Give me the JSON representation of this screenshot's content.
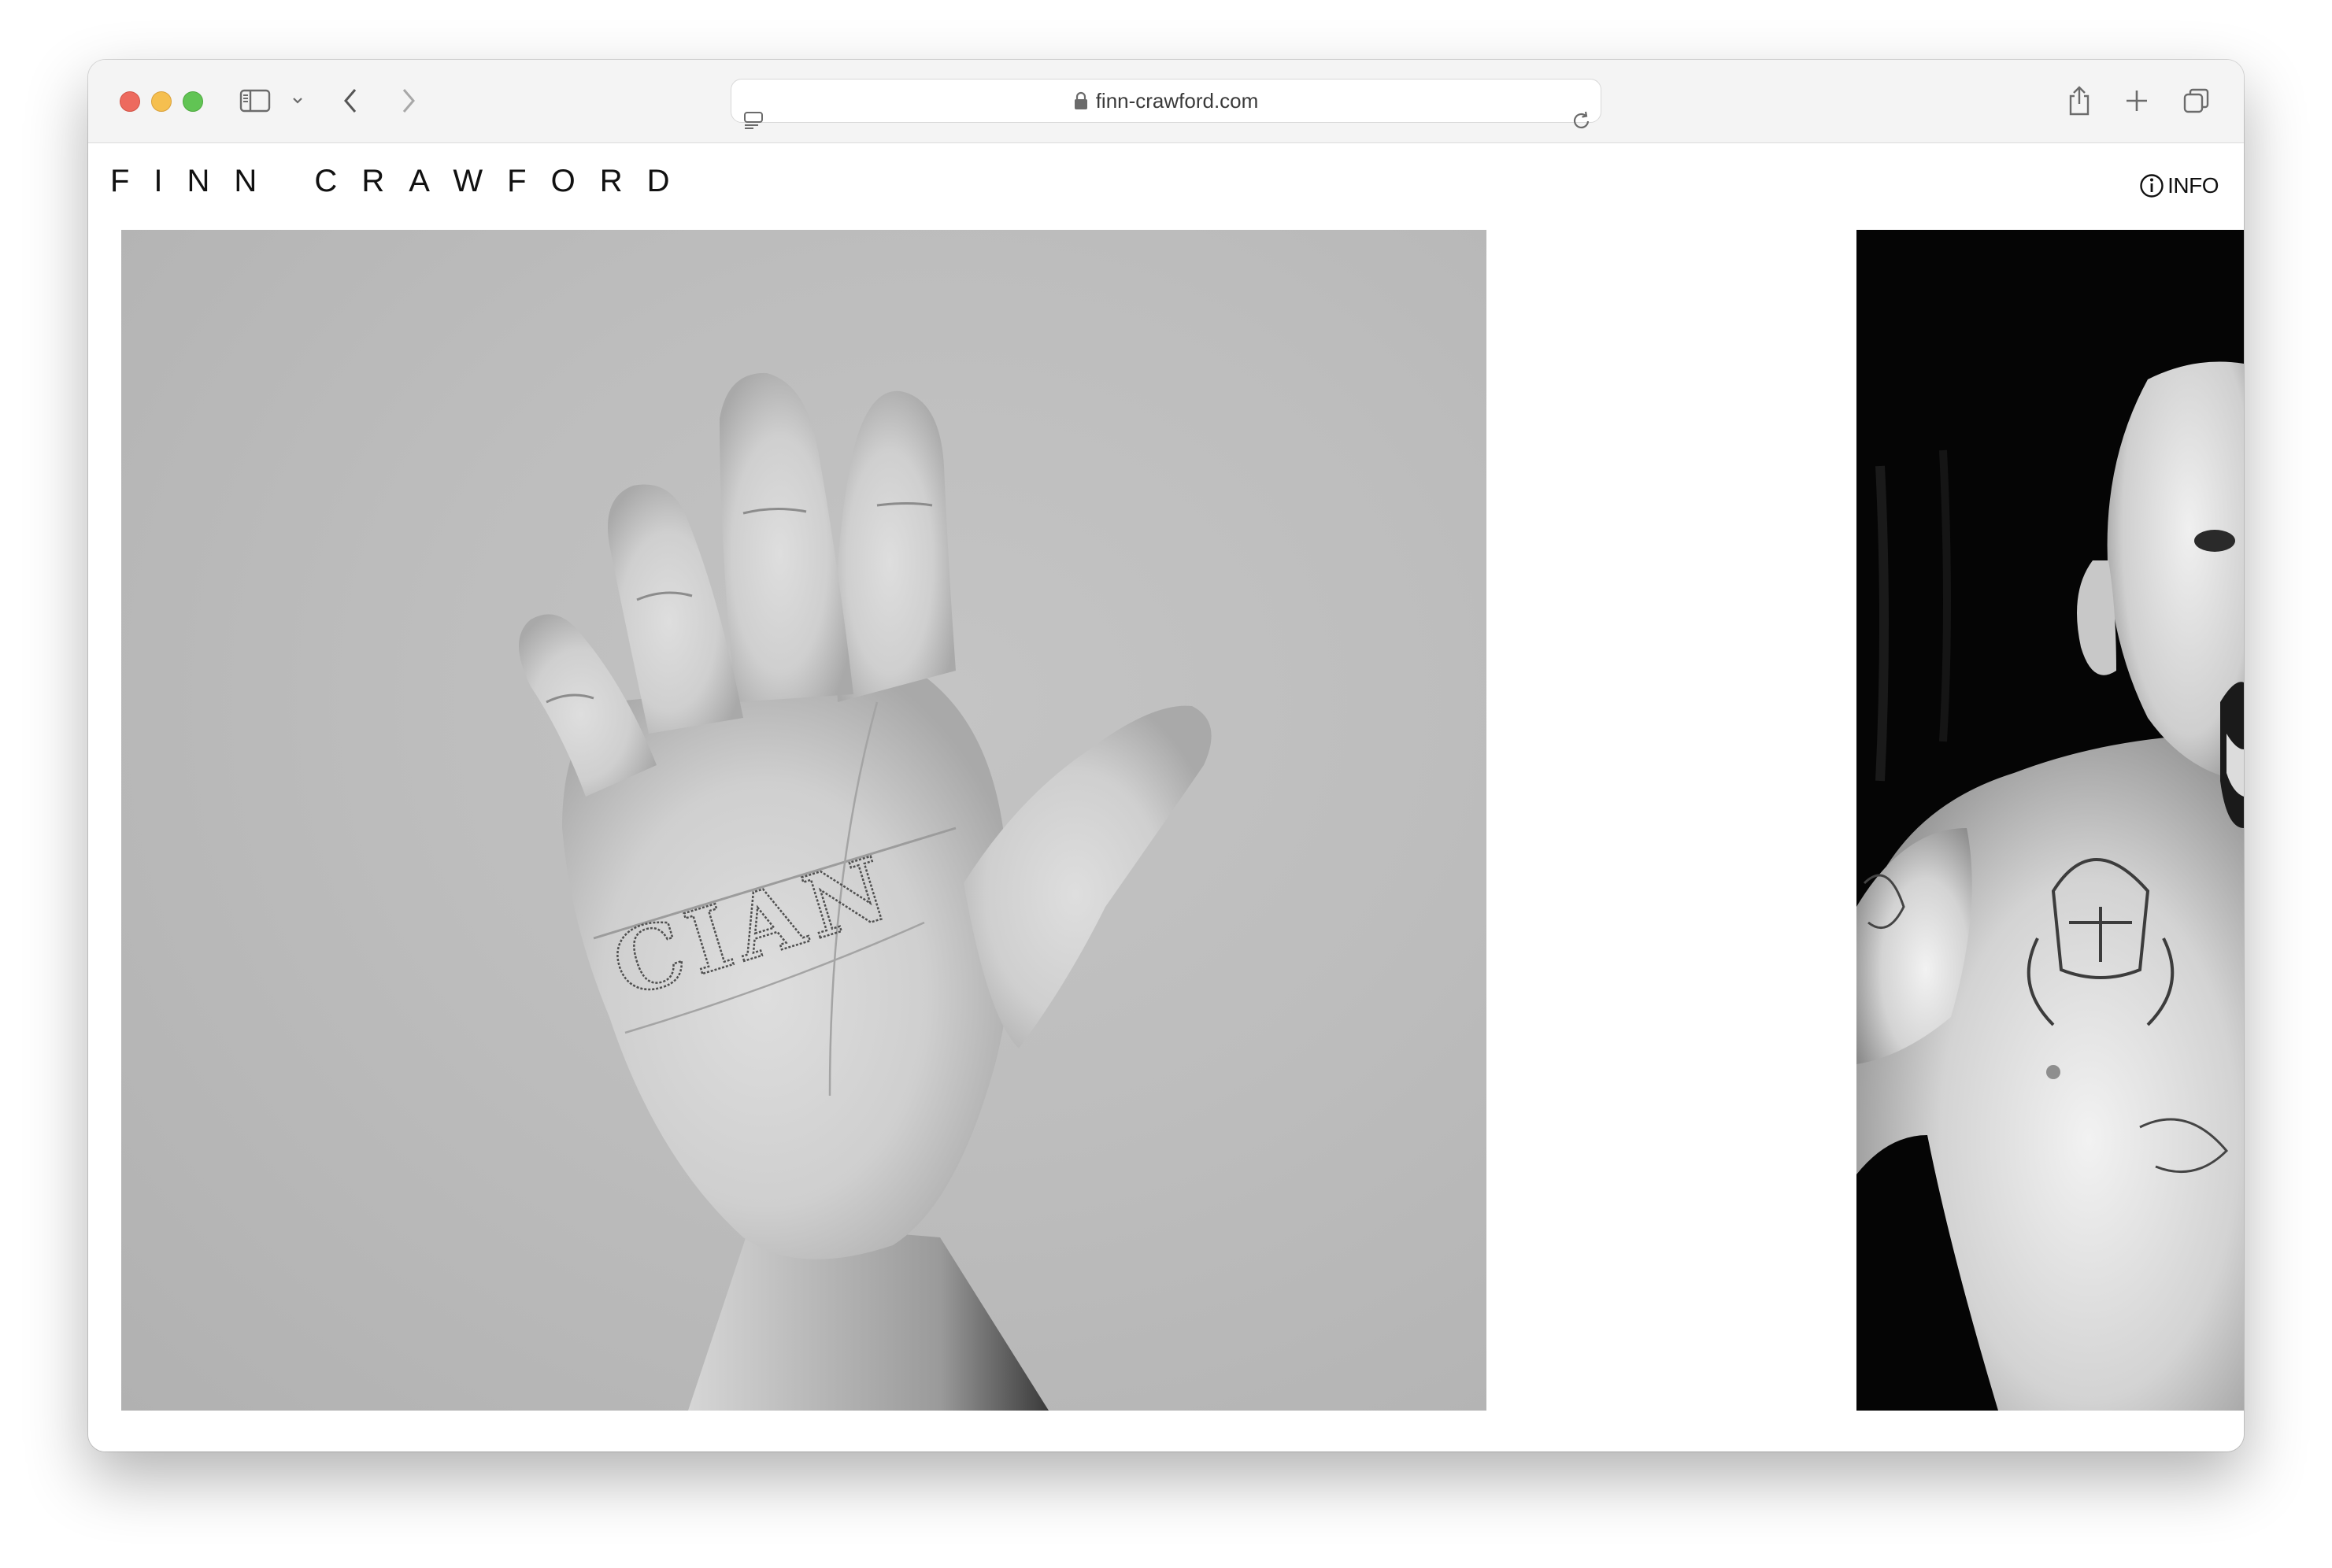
{
  "browser": {
    "url": "finn-crawford.com",
    "icons": {
      "sidebar": "sidebar-icon",
      "sidebar_menu": "chevron-down-icon",
      "back": "chevron-left-icon",
      "forward": "chevron-right-icon",
      "page_menu": "page-menu-icon",
      "lock": "lock-icon",
      "reload": "reload-icon",
      "share": "share-icon",
      "new_tab": "plus-icon",
      "tab_overview": "tabs-icon"
    }
  },
  "site": {
    "title": "FINN CRAWFORD",
    "info_label": "INFO"
  },
  "gallery": {
    "photos": [
      {
        "name": "hand-photo",
        "tattoo_text": "CIAN"
      },
      {
        "name": "portrait-photo"
      }
    ]
  },
  "colors": {
    "close": "#ed6a5e",
    "minimize": "#f5bf4f",
    "zoom": "#61c454"
  }
}
